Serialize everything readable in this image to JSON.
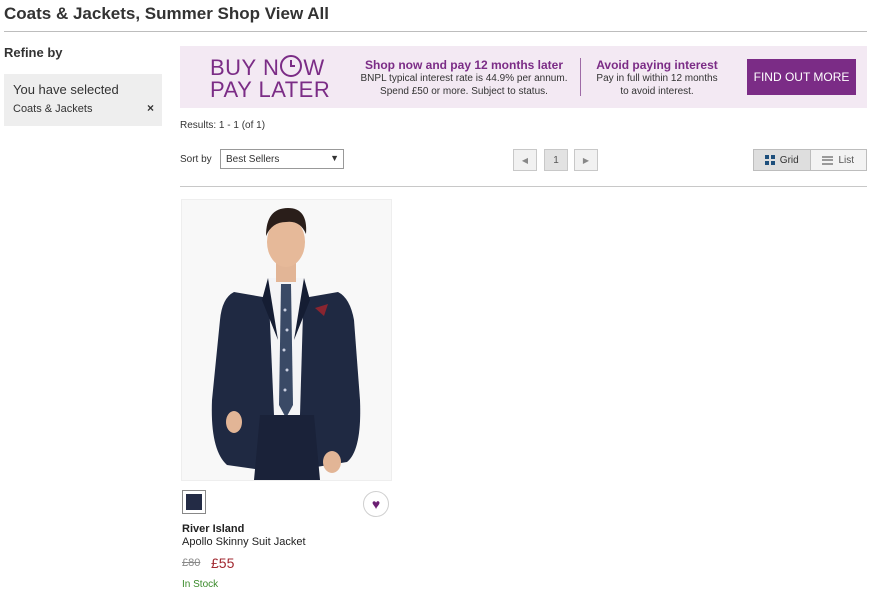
{
  "page": {
    "title": "Coats & Jackets, Summer Shop View All"
  },
  "refine": {
    "title": "Refine by",
    "selected_heading": "You have selected",
    "selected_item": "Coats & Jackets",
    "remove_symbol": "×"
  },
  "banner": {
    "title_line1_a": "BUY N",
    "title_line1_b": "W",
    "title_line2": "PAY LATER",
    "col1_heading": "Shop now and pay 12 months later",
    "col1_line1": "BNPL typical interest rate is 44.9% per annum.",
    "col1_line2": "Spend £50 or more. Subject to status.",
    "col2_heading": "Avoid paying interest",
    "col2_line1": "Pay in full within 12 months",
    "col2_line2": "to avoid interest.",
    "cta": "FIND OUT MORE",
    "accent_color": "#7b2c86"
  },
  "results": {
    "text": "Results: 1 - 1 (of 1)"
  },
  "sort": {
    "label": "Sort by",
    "selected": "Best Sellers"
  },
  "pager": {
    "prev": "◀",
    "current": "1",
    "next": "▶"
  },
  "view": {
    "grid_label": "Grid",
    "list_label": "List",
    "active": "grid"
  },
  "product": {
    "brand": "River Island",
    "name": "Apollo Skinny Suit Jacket",
    "old_price": "£80",
    "price": "£55",
    "stock": "In Stock",
    "swatch_color": "#232b45",
    "wishlist_icon": "heart-icon"
  }
}
